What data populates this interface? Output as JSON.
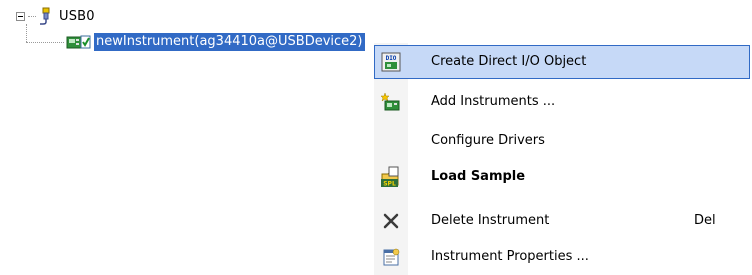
{
  "tree": {
    "root": {
      "label": "USB0",
      "icon": "usb-plug-icon",
      "expander": "minus"
    },
    "child": {
      "label": "newInstrument(ag34410a@USBDevice2)",
      "icon": "instrument-check-icon",
      "selected": true
    }
  },
  "context_menu": {
    "items": [
      {
        "label": "Create Direct I/O Object",
        "icon": "dio-icon",
        "selected": true,
        "bold": false,
        "shortcut": ""
      },
      {
        "label": "Add Instruments ...",
        "icon": "add-instrument-icon",
        "selected": false,
        "bold": false,
        "shortcut": ""
      },
      {
        "label": "Configure Drivers",
        "icon": "",
        "selected": false,
        "bold": false,
        "shortcut": ""
      },
      {
        "label": "Load Sample",
        "icon": "load-sample-icon",
        "selected": false,
        "bold": true,
        "shortcut": ""
      },
      {
        "label": "Delete Instrument",
        "icon": "delete-x-icon",
        "selected": false,
        "bold": false,
        "shortcut": "Del"
      },
      {
        "label": "Instrument Properties ...",
        "icon": "properties-icon",
        "selected": false,
        "bold": false,
        "shortcut": ""
      }
    ],
    "icon_text": {
      "dio": "DIO",
      "spl": "SPL"
    }
  },
  "colors": {
    "selection": "#316ac5",
    "menu_highlight": "#c6d9f7"
  }
}
